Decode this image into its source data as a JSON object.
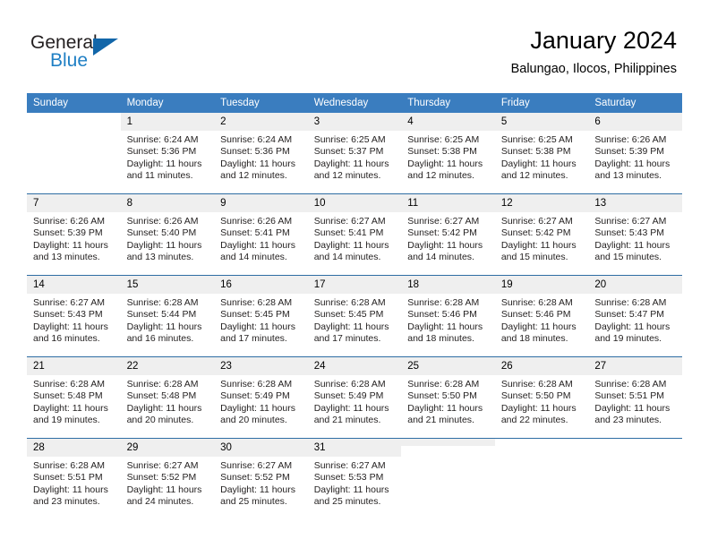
{
  "brand": {
    "name_top": "General",
    "name_bottom": "Blue",
    "accent_color": "#1266a9",
    "text_color": "#231f20",
    "blue_text_color": "#1f7fc4"
  },
  "header": {
    "title": "January 2024",
    "subtitle": "Balungao, Ilocos, Philippines"
  },
  "colors": {
    "header_row_bg": "#3a7dbf",
    "header_row_text": "#ffffff",
    "daynum_bg": "#efefef",
    "row_divider": "#2e6da4",
    "body_text": "#221f1f"
  },
  "weekday_headers": [
    "Sunday",
    "Monday",
    "Tuesday",
    "Wednesday",
    "Thursday",
    "Friday",
    "Saturday"
  ],
  "weeks": [
    [
      {
        "day": "",
        "state": "blank",
        "sunrise": "",
        "sunset": "",
        "daylight_line1": "",
        "daylight_line2": ""
      },
      {
        "day": "1",
        "state": "filled",
        "sunrise": "Sunrise: 6:24 AM",
        "sunset": "Sunset: 5:36 PM",
        "daylight_line1": "Daylight: 11 hours",
        "daylight_line2": "and 11 minutes."
      },
      {
        "day": "2",
        "state": "filled",
        "sunrise": "Sunrise: 6:24 AM",
        "sunset": "Sunset: 5:36 PM",
        "daylight_line1": "Daylight: 11 hours",
        "daylight_line2": "and 12 minutes."
      },
      {
        "day": "3",
        "state": "filled",
        "sunrise": "Sunrise: 6:25 AM",
        "sunset": "Sunset: 5:37 PM",
        "daylight_line1": "Daylight: 11 hours",
        "daylight_line2": "and 12 minutes."
      },
      {
        "day": "4",
        "state": "filled",
        "sunrise": "Sunrise: 6:25 AM",
        "sunset": "Sunset: 5:38 PM",
        "daylight_line1": "Daylight: 11 hours",
        "daylight_line2": "and 12 minutes."
      },
      {
        "day": "5",
        "state": "filled",
        "sunrise": "Sunrise: 6:25 AM",
        "sunset": "Sunset: 5:38 PM",
        "daylight_line1": "Daylight: 11 hours",
        "daylight_line2": "and 12 minutes."
      },
      {
        "day": "6",
        "state": "filled",
        "sunrise": "Sunrise: 6:26 AM",
        "sunset": "Sunset: 5:39 PM",
        "daylight_line1": "Daylight: 11 hours",
        "daylight_line2": "and 13 minutes."
      }
    ],
    [
      {
        "day": "7",
        "state": "filled",
        "sunrise": "Sunrise: 6:26 AM",
        "sunset": "Sunset: 5:39 PM",
        "daylight_line1": "Daylight: 11 hours",
        "daylight_line2": "and 13 minutes."
      },
      {
        "day": "8",
        "state": "filled",
        "sunrise": "Sunrise: 6:26 AM",
        "sunset": "Sunset: 5:40 PM",
        "daylight_line1": "Daylight: 11 hours",
        "daylight_line2": "and 13 minutes."
      },
      {
        "day": "9",
        "state": "filled",
        "sunrise": "Sunrise: 6:26 AM",
        "sunset": "Sunset: 5:41 PM",
        "daylight_line1": "Daylight: 11 hours",
        "daylight_line2": "and 14 minutes."
      },
      {
        "day": "10",
        "state": "filled",
        "sunrise": "Sunrise: 6:27 AM",
        "sunset": "Sunset: 5:41 PM",
        "daylight_line1": "Daylight: 11 hours",
        "daylight_line2": "and 14 minutes."
      },
      {
        "day": "11",
        "state": "filled",
        "sunrise": "Sunrise: 6:27 AM",
        "sunset": "Sunset: 5:42 PM",
        "daylight_line1": "Daylight: 11 hours",
        "daylight_line2": "and 14 minutes."
      },
      {
        "day": "12",
        "state": "filled",
        "sunrise": "Sunrise: 6:27 AM",
        "sunset": "Sunset: 5:42 PM",
        "daylight_line1": "Daylight: 11 hours",
        "daylight_line2": "and 15 minutes."
      },
      {
        "day": "13",
        "state": "filled",
        "sunrise": "Sunrise: 6:27 AM",
        "sunset": "Sunset: 5:43 PM",
        "daylight_line1": "Daylight: 11 hours",
        "daylight_line2": "and 15 minutes."
      }
    ],
    [
      {
        "day": "14",
        "state": "filled",
        "sunrise": "Sunrise: 6:27 AM",
        "sunset": "Sunset: 5:43 PM",
        "daylight_line1": "Daylight: 11 hours",
        "daylight_line2": "and 16 minutes."
      },
      {
        "day": "15",
        "state": "filled",
        "sunrise": "Sunrise: 6:28 AM",
        "sunset": "Sunset: 5:44 PM",
        "daylight_line1": "Daylight: 11 hours",
        "daylight_line2": "and 16 minutes."
      },
      {
        "day": "16",
        "state": "filled",
        "sunrise": "Sunrise: 6:28 AM",
        "sunset": "Sunset: 5:45 PM",
        "daylight_line1": "Daylight: 11 hours",
        "daylight_line2": "and 17 minutes."
      },
      {
        "day": "17",
        "state": "filled",
        "sunrise": "Sunrise: 6:28 AM",
        "sunset": "Sunset: 5:45 PM",
        "daylight_line1": "Daylight: 11 hours",
        "daylight_line2": "and 17 minutes."
      },
      {
        "day": "18",
        "state": "filled",
        "sunrise": "Sunrise: 6:28 AM",
        "sunset": "Sunset: 5:46 PM",
        "daylight_line1": "Daylight: 11 hours",
        "daylight_line2": "and 18 minutes."
      },
      {
        "day": "19",
        "state": "filled",
        "sunrise": "Sunrise: 6:28 AM",
        "sunset": "Sunset: 5:46 PM",
        "daylight_line1": "Daylight: 11 hours",
        "daylight_line2": "and 18 minutes."
      },
      {
        "day": "20",
        "state": "filled",
        "sunrise": "Sunrise: 6:28 AM",
        "sunset": "Sunset: 5:47 PM",
        "daylight_line1": "Daylight: 11 hours",
        "daylight_line2": "and 19 minutes."
      }
    ],
    [
      {
        "day": "21",
        "state": "filled",
        "sunrise": "Sunrise: 6:28 AM",
        "sunset": "Sunset: 5:48 PM",
        "daylight_line1": "Daylight: 11 hours",
        "daylight_line2": "and 19 minutes."
      },
      {
        "day": "22",
        "state": "filled",
        "sunrise": "Sunrise: 6:28 AM",
        "sunset": "Sunset: 5:48 PM",
        "daylight_line1": "Daylight: 11 hours",
        "daylight_line2": "and 20 minutes."
      },
      {
        "day": "23",
        "state": "filled",
        "sunrise": "Sunrise: 6:28 AM",
        "sunset": "Sunset: 5:49 PM",
        "daylight_line1": "Daylight: 11 hours",
        "daylight_line2": "and 20 minutes."
      },
      {
        "day": "24",
        "state": "filled",
        "sunrise": "Sunrise: 6:28 AM",
        "sunset": "Sunset: 5:49 PM",
        "daylight_line1": "Daylight: 11 hours",
        "daylight_line2": "and 21 minutes."
      },
      {
        "day": "25",
        "state": "filled",
        "sunrise": "Sunrise: 6:28 AM",
        "sunset": "Sunset: 5:50 PM",
        "daylight_line1": "Daylight: 11 hours",
        "daylight_line2": "and 21 minutes."
      },
      {
        "day": "26",
        "state": "filled",
        "sunrise": "Sunrise: 6:28 AM",
        "sunset": "Sunset: 5:50 PM",
        "daylight_line1": "Daylight: 11 hours",
        "daylight_line2": "and 22 minutes."
      },
      {
        "day": "27",
        "state": "filled",
        "sunrise": "Sunrise: 6:28 AM",
        "sunset": "Sunset: 5:51 PM",
        "daylight_line1": "Daylight: 11 hours",
        "daylight_line2": "and 23 minutes."
      }
    ],
    [
      {
        "day": "28",
        "state": "filled",
        "sunrise": "Sunrise: 6:28 AM",
        "sunset": "Sunset: 5:51 PM",
        "daylight_line1": "Daylight: 11 hours",
        "daylight_line2": "and 23 minutes."
      },
      {
        "day": "29",
        "state": "filled",
        "sunrise": "Sunrise: 6:27 AM",
        "sunset": "Sunset: 5:52 PM",
        "daylight_line1": "Daylight: 11 hours",
        "daylight_line2": "and 24 minutes."
      },
      {
        "day": "30",
        "state": "filled",
        "sunrise": "Sunrise: 6:27 AM",
        "sunset": "Sunset: 5:52 PM",
        "daylight_line1": "Daylight: 11 hours",
        "daylight_line2": "and 25 minutes."
      },
      {
        "day": "31",
        "state": "filled",
        "sunrise": "Sunrise: 6:27 AM",
        "sunset": "Sunset: 5:53 PM",
        "daylight_line1": "Daylight: 11 hours",
        "daylight_line2": "and 25 minutes."
      },
      {
        "day": "",
        "state": "empty",
        "sunrise": "",
        "sunset": "",
        "daylight_line1": "",
        "daylight_line2": ""
      },
      {
        "day": "",
        "state": "blank",
        "sunrise": "",
        "sunset": "",
        "daylight_line1": "",
        "daylight_line2": ""
      },
      {
        "day": "",
        "state": "blank",
        "sunrise": "",
        "sunset": "",
        "daylight_line1": "",
        "daylight_line2": ""
      }
    ]
  ]
}
